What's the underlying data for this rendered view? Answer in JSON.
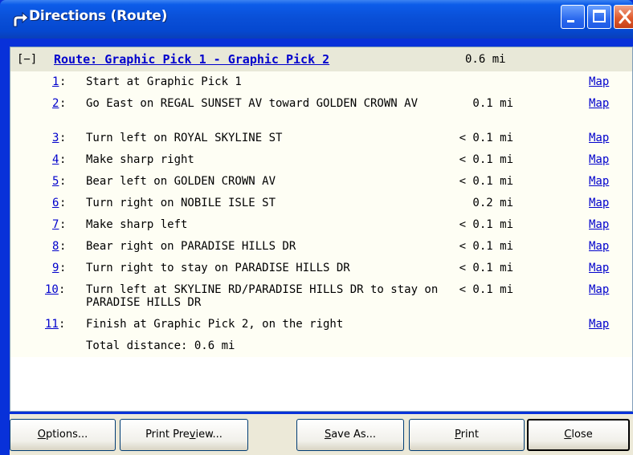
{
  "window": {
    "title": "Directions (Route)"
  },
  "route": {
    "expander": "[−]",
    "title": "Route: Graphic Pick 1 - Graphic Pick 2",
    "distance": "0.6 mi"
  },
  "steps": [
    {
      "num": "1",
      "instruction": "Start at Graphic Pick 1",
      "distance": "",
      "map": "Map"
    },
    {
      "num": "2",
      "instruction": "Go East on REGAL SUNSET AV toward GOLDEN CROWN AV",
      "distance": "0.1 mi",
      "map": "Map"
    },
    {
      "num": "3",
      "instruction": "Turn left on ROYAL SKYLINE ST",
      "distance": "< 0.1 mi",
      "map": "Map"
    },
    {
      "num": "4",
      "instruction": "Make sharp right",
      "distance": "< 0.1 mi",
      "map": "Map"
    },
    {
      "num": "5",
      "instruction": "Bear left on GOLDEN CROWN AV",
      "distance": "< 0.1 mi",
      "map": "Map"
    },
    {
      "num": "6",
      "instruction": "Turn right on NOBILE ISLE ST",
      "distance": "0.2 mi",
      "map": "Map"
    },
    {
      "num": "7",
      "instruction": "Make sharp left",
      "distance": "< 0.1 mi",
      "map": "Map"
    },
    {
      "num": "8",
      "instruction": "Bear right on PARADISE HILLS DR",
      "distance": "< 0.1 mi",
      "map": "Map"
    },
    {
      "num": "9",
      "instruction": "Turn right to stay on PARADISE HILLS DR",
      "distance": "< 0.1 mi",
      "map": "Map"
    },
    {
      "num": "10",
      "instruction": "Turn left at SKYLINE RD/PARADISE HILLS DR to stay on PARADISE HILLS DR",
      "distance": "< 0.1 mi",
      "map": "Map"
    },
    {
      "num": "11",
      "instruction": "Finish at Graphic Pick 2, on the right",
      "distance": "",
      "map": "Map"
    }
  ],
  "total": "Total distance: 0.6 mi",
  "buttons": {
    "options": {
      "mnemonic": "O",
      "rest": "ptions..."
    },
    "print_preview": {
      "pre": "Print Pre",
      "mnemonic": "v",
      "rest": "iew..."
    },
    "save_as": {
      "mnemonic": "S",
      "rest": "ave As..."
    },
    "print": {
      "mnemonic": "P",
      "rest": "rint"
    },
    "close": {
      "mnemonic": "C",
      "rest": "lose"
    }
  },
  "colors": {
    "title_bar": "#0a50d8",
    "link": "#0000cc",
    "header_bg": "#e8e8d8"
  },
  "icons": {
    "title": "route-arrow-icon",
    "minimize": "minimize-icon",
    "maximize": "maximize-icon",
    "close": "close-icon"
  }
}
